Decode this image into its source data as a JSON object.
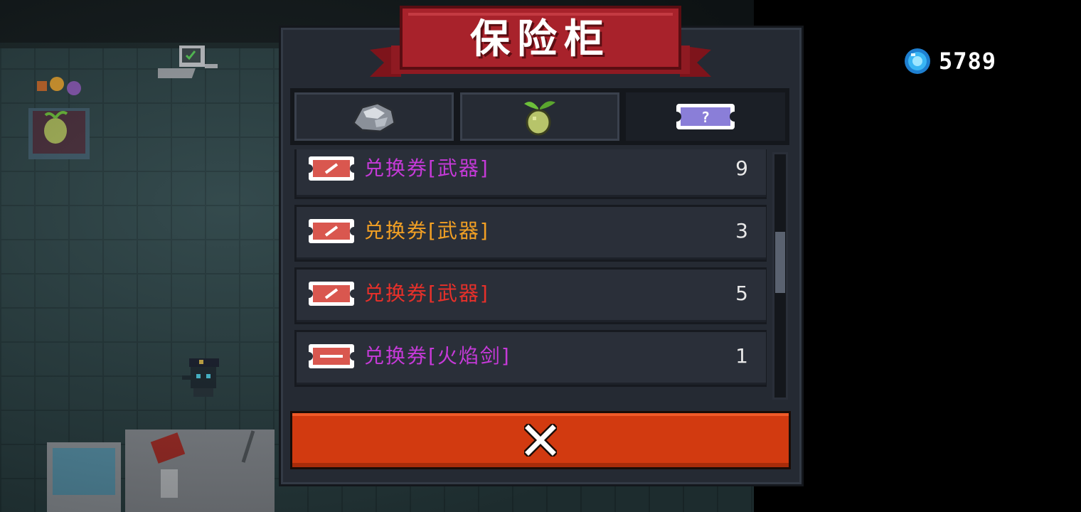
{
  "hud": {
    "currency_icon": "blue-gem-icon",
    "currency_amount": "5789"
  },
  "dialog": {
    "title": "保险柜",
    "tabs": [
      {
        "icon": "ore-icon",
        "active": false
      },
      {
        "icon": "seed-icon",
        "active": false
      },
      {
        "icon": "ticket-icon",
        "active": true
      }
    ],
    "items": [
      {
        "icon": "weapon-ticket-icon",
        "name": "兑换券[武器]",
        "count": "9",
        "color": "#c53ad8"
      },
      {
        "icon": "weapon-ticket-icon",
        "name": "兑换券[武器]",
        "count": "3",
        "color": "#f2a024"
      },
      {
        "icon": "weapon-ticket-icon",
        "name": "兑换券[武器]",
        "count": "5",
        "color": "#e8302a"
      },
      {
        "icon": "sword-ticket-icon",
        "name": "兑换券[火焰剑]",
        "count": "1",
        "color": "#c53ad8"
      }
    ],
    "close_icon": "close-x-icon"
  },
  "colors": {
    "banner": "#a8222b",
    "close_button": "#d23a10",
    "panel": "#252a33"
  }
}
